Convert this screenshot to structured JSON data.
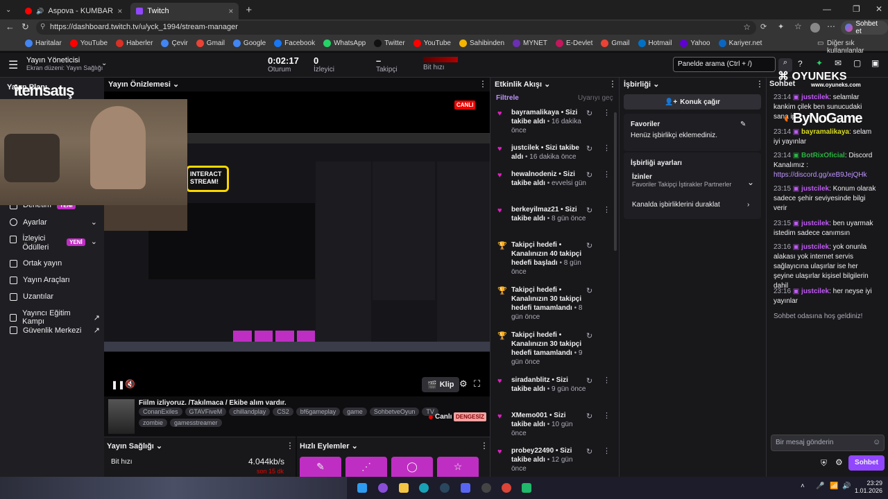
{
  "browser": {
    "tabs": [
      {
        "label": "Aspova - KUMBARA ft. Hidra"
      },
      {
        "label": "Twitch"
      }
    ],
    "url": "https://dashboard.twitch.tv/u/yck_1994/stream-manager",
    "chat_btn": "Sohbet et",
    "bookmarks": [
      "Haritalar",
      "YouTube",
      "Haberler",
      "Çevir",
      "Gmail",
      "Google",
      "Facebook",
      "WhatsApp",
      "Twitter",
      "YouTube",
      "Sahibinden",
      "MYNET",
      "E-Devlet",
      "Gmail",
      "Hotmail",
      "Yahoo",
      "Kariyer.net"
    ],
    "other_bookmarks": "Diğer sık kullanılanlar"
  },
  "topbar": {
    "title": "Yayın Yöneticisi",
    "subtitle": "Ekran düzeni: Yayın Sağlığı",
    "session_time": "0:02:17",
    "session_label": "Oturum",
    "viewers": "0",
    "viewers_label": "İzleyici",
    "followers": "–",
    "followers_label": "Takipçi",
    "bitrate_label": "Bit hızı",
    "search_placeholder": "Panelde arama (Ctrl + /)"
  },
  "left_nav": {
    "header": "Yayın Planı",
    "items": [
      {
        "label": "Denetim",
        "badge": "YENİ"
      },
      {
        "label": "Ayarlar"
      },
      {
        "label": "İzleyici Ödülleri",
        "badge": "YENİ"
      },
      {
        "label": "Ortak yayın"
      },
      {
        "label": "Yayın Araçları"
      },
      {
        "label": "Uzantılar"
      },
      {
        "label": "Yayıncı Eğitim Kampı"
      },
      {
        "label": "Güvenlik Merkezi"
      }
    ]
  },
  "preview": {
    "header": "Yayın Önizlemesi",
    "live_badge": "CANLI",
    "clip_label": "Klip",
    "stream_title": "Fiilm izliyoruz. /Takılmaca / Ekibe alım vardır.",
    "tags": [
      "ConanExiles",
      "GTAVFiveM",
      "chillandplay",
      "CS2",
      "bf6gameplay",
      "game",
      "SohbetveOyun",
      "TV",
      "zombie",
      "gamesstreamer"
    ],
    "live_label": "Canlı",
    "unstable_badge": "DENGESİZ",
    "health_header": "Yayın Sağlığı",
    "health_bitrate_label": "Bit hızı",
    "health_bitrate_value": "4.044kb/s",
    "health_bitrate_sub": "son 15 dk",
    "quick_actions_header": "Hızlı Eylemler",
    "overlay_text": "INTERACT STREAM!",
    "watermark": "itemsatış"
  },
  "activity": {
    "header": "Etkinlik Akışı",
    "filter": "Filtrele",
    "skip": "Uyarıyı geç",
    "items": [
      {
        "type": "follow",
        "user": "bayramalikaya",
        "text": "• Sizi takibe aldı",
        "time": "• 16 dakika önce"
      },
      {
        "type": "follow",
        "user": "justcilek",
        "text": "• Sizi takibe aldı",
        "time": "• 16 dakika önce"
      },
      {
        "type": "follow",
        "user": "hewalnodeniz",
        "text": "• Sizi takibe aldı",
        "time": "• evvelsi gün"
      },
      {
        "type": "follow",
        "user": "berkeyilmaz21",
        "text": "• Sizi takibe aldı",
        "time": "• 8 gün önce"
      },
      {
        "type": "goal",
        "user": "Takipçi hedefi",
        "text": "• Kanalınızın 40 takipçi hedefi başladı",
        "time": "• 8 gün önce"
      },
      {
        "type": "goal",
        "user": "Takipçi hedefi",
        "text": "• Kanalınızın 30 takipçi hedefi tamamlandı",
        "time": "• 8 gün önce"
      },
      {
        "type": "goal",
        "user": "Takipçi hedefi",
        "text": "• Kanalınızın 30 takipçi hedefi tamamlandı",
        "time": "• 9 gün önce"
      },
      {
        "type": "follow",
        "user": "siradanblitz",
        "text": "• Sizi takibe aldı",
        "time": "• 9 gün önce"
      },
      {
        "type": "follow",
        "user": "XMemo001",
        "text": "• Sizi takibe aldı",
        "time": "• 10 gün önce"
      },
      {
        "type": "follow",
        "user": "probey22490",
        "text": "• Sizi takibe aldı",
        "time": "• 12 gün önce"
      }
    ]
  },
  "collab": {
    "header": "İşbirliği",
    "invite_btn": "Konuk çağır",
    "favorites_title": "Favoriler",
    "favorites_empty": "Henüz işbirlikçi eklemediniz.",
    "settings_title": "İşbirliği ayarları",
    "permissions_title": "İzinler",
    "permissions_value": "Favoriler Takipçi İştirakler Partnerler",
    "pause_label": "Kanalda işbirliklerini duraklat"
  },
  "chat": {
    "header": "Sohbet",
    "brand_top": "OYUNEKS",
    "brand_url": "www.oyuneks.com",
    "brand_bottom": "ByNoGame",
    "messages": [
      {
        "time": "23:14",
        "user": "justcilek",
        "text": ": selamlar kankim çilek ben sunucudaki sana ip"
      },
      {
        "time": "23:14",
        "user": "bayramalikaya",
        "text": ": selam iyi yayınlar"
      },
      {
        "time": "23:14",
        "user": "BotRixOficial",
        "text": ": Discord Kanalımız :",
        "link": "https://discord.gg/xeB9JejQHk"
      },
      {
        "time": "23:15",
        "user": "justcilek",
        "text": ": Konum olarak sadece şehir seviyesinde bilgi verir"
      },
      {
        "time": "23:15",
        "user": "justcilek",
        "text": ": ben uyarmak istedim sadece canımsın"
      },
      {
        "time": "23:16",
        "user": "justcilek",
        "text": ": yok onunla alakası yok internet servis sağlayıcına ulaşırlar ise her şeyine ulaşırlar kişisel bilgilerin dahil"
      },
      {
        "time": "23:16",
        "user": "justcilek",
        "text": ": her neyse iyi yayınlar"
      }
    ],
    "welcome": "Sohbet odasına hoş geldiniz!",
    "input_placeholder": "Bir mesaj gönderin",
    "send_btn": "Sohbet"
  },
  "taskbar": {
    "time": "23:29",
    "date": "1.01.2026"
  },
  "colors": {
    "twitch_purple": "#9147ff",
    "magenta": "#e020c0",
    "live_red": "#eb0400"
  }
}
